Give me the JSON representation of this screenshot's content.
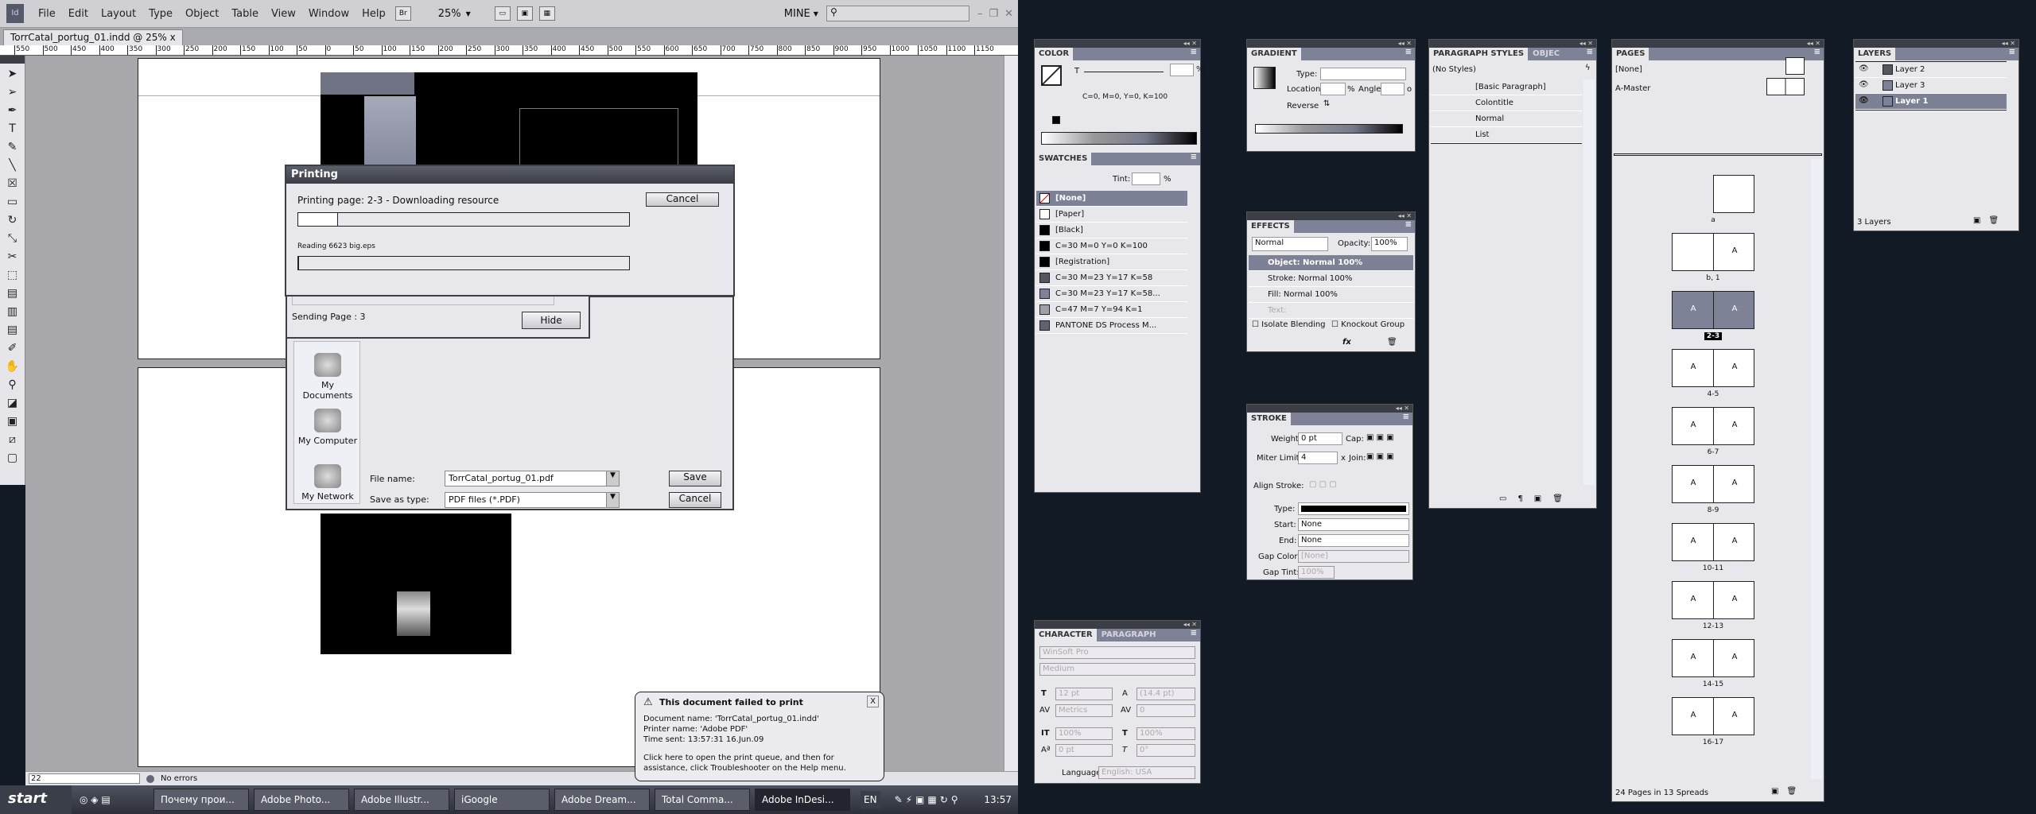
{
  "app": {
    "menu": [
      "File",
      "Edit",
      "Layout",
      "Type",
      "Object",
      "Table",
      "View",
      "Window",
      "Help"
    ],
    "bridge_label": "Br",
    "zoom": "25%",
    "workspace": "MINE",
    "search_placeholder": "",
    "window_controls": [
      "–",
      "❐",
      "✕"
    ],
    "doc_tab": "TorrCatal_portug_01.indd @ 25%",
    "doc_tab_close": "x"
  },
  "ruler_labels": [
    "550",
    "500",
    "450",
    "400",
    "350",
    "300",
    "250",
    "200",
    "150",
    "100",
    "50",
    "0",
    "50",
    "100",
    "150",
    "200",
    "250",
    "300",
    "350",
    "400",
    "450",
    "500",
    "550",
    "600",
    "650",
    "700",
    "750",
    "800",
    "850",
    "900",
    "950",
    "1000",
    "1050",
    "1100",
    "1150"
  ],
  "tools": [
    "selection-tool",
    "direct-selection-tool",
    "pen-tool",
    "type-tool",
    "pencil-tool",
    "line-tool",
    "rectangle-frame-tool",
    "rectangle-tool",
    "rotate-tool",
    "scale-tool",
    "scissors-tool",
    "free-transform-tool",
    "gradient-tool",
    "gradient-feather-tool",
    "note-tool",
    "eyedropper-tool",
    "hand-tool",
    "zoom-tool",
    "fill-stroke-tool",
    "formatting-tool",
    "apply-none-tool",
    "screen-mode-tool"
  ],
  "status": {
    "page": "22",
    "errors": "No errors"
  },
  "printing": {
    "title": "Printing",
    "status": "Printing page: 2-3 - Downloading resource",
    "progress": 0.12,
    "reading": "Reading 6623 big.eps",
    "progress2": 0.0,
    "cancel": "Cancel"
  },
  "sending": {
    "text": "Sending Page : 3",
    "hide": "Hide"
  },
  "save_dialog": {
    "places": [
      "My Documents",
      "My Computer",
      "My Network"
    ],
    "file_name_label": "File name:",
    "file_name": "TorrCatal_portug_01.pdf",
    "type_label": "Save as type:",
    "type": "PDF files (*.PDF)",
    "save": "Save",
    "cancel": "Cancel"
  },
  "balloon": {
    "title": "This document failed to print",
    "lines": [
      "Document name: 'TorrCatal_portug_01.indd'",
      "Printer name: 'Adobe PDF'",
      "Time sent: 13:57:31  16.Jun.09"
    ],
    "help": "Click here to open the print queue, and then for assistance, click Troubleshooter on the Help menu.",
    "close": "X"
  },
  "taskbar": {
    "start": "start",
    "items": [
      "Почему прои...",
      "Adobe Photo...",
      "Adobe Illustr...",
      "iGoogle",
      "Adobe Dream...",
      "Total Comma...",
      "Adobe InDesi..."
    ],
    "active": 6,
    "lang": "EN",
    "time": "13:57"
  },
  "color_panel": {
    "title": "COLOR",
    "t_label": "T",
    "pct": "%",
    "value": "C=0, M=0, Y=0, K=100"
  },
  "swatches": {
    "title": "SWATCHES",
    "tint_label": "Tint:",
    "pct": "%",
    "items": [
      {
        "name": "[None]",
        "color": "none"
      },
      {
        "name": "[Paper]",
        "color": "#ffffff"
      },
      {
        "name": "[Black]",
        "color": "#000000"
      },
      {
        "name": "C=30 M=0 Y=0 K=100",
        "color": "#000000"
      },
      {
        "name": "[Registration]",
        "color": "#000000"
      },
      {
        "name": "C=30 M=23 Y=17 K=58",
        "color": "#55575f"
      },
      {
        "name": "C=30 M=23 Y=17 K=58...",
        "color": "#7d8296"
      },
      {
        "name": "C=47 M=7 Y=94 K=1",
        "color": "#a0a0a8"
      },
      {
        "name": "PANTONE DS Process M...",
        "color": "#606270"
      }
    ]
  },
  "gradient": {
    "title": "GRADIENT",
    "type_label": "Type:",
    "location_label": "Location:",
    "pct": "%",
    "angle_label": "Angle:",
    "deg": "o",
    "reverse_label": "Reverse"
  },
  "effects": {
    "title": "EFFECTS",
    "mode": "Normal",
    "opacity_label": "Opacity:",
    "opacity": "100%",
    "rows": [
      "Object: Normal 100%",
      "Stroke:  Normal 100%",
      "Fill:      Normal 100%",
      "Text:"
    ],
    "isolate": "Isolate Blending",
    "knockout": "Knockout Group"
  },
  "stroke": {
    "title": "STROKE",
    "weight_label": "Weight:",
    "weight": "0 pt",
    "cap_label": "Cap:",
    "miter_label": "Miter Limit:",
    "miter": "4",
    "x": "x",
    "join_label": "Join:",
    "align_label": "Align Stroke:",
    "type_label": "Type:",
    "start_label": "Start:",
    "start": "None",
    "end_label": "End:",
    "end": "None",
    "gap_color_label": "Gap Color:",
    "gap_color": "[None]",
    "gap_tint_label": "Gap Tint:",
    "gap_tint": "100%"
  },
  "character": {
    "title": "CHARACTER",
    "tab2": "PARAGRAPH",
    "font": "WinSoft Pro",
    "style": "Medium",
    "size": "12 pt",
    "leading": "(14.4 pt)",
    "kerning": "Metrics",
    "tracking": "0",
    "vscale": "100%",
    "hscale": "100%",
    "baseline": "0 pt",
    "skew": "0°",
    "language_label": "Language:",
    "language": "English: USA"
  },
  "paragraph_styles": {
    "title": "PARAGRAPH STYLES",
    "tab2": "OBJEC",
    "current": "(No Styles)",
    "items": [
      "[Basic Paragraph]",
      "Colontitle",
      "Normal",
      "List"
    ]
  },
  "pages": {
    "title": "PAGES",
    "masters": [
      "[None]",
      "A-Master"
    ],
    "spreads": [
      {
        "label": "a",
        "left": null,
        "right": ""
      },
      {
        "label": "b, 1",
        "left": "",
        "right": "A"
      },
      {
        "label": "2-3",
        "left": "A",
        "right": "A",
        "selected": true
      },
      {
        "label": "4-5",
        "left": "A",
        "right": "A"
      },
      {
        "label": "6-7",
        "left": "A",
        "right": "A"
      },
      {
        "label": "8-9",
        "left": "A",
        "right": "A"
      },
      {
        "label": "10-11",
        "left": "A",
        "right": "A"
      },
      {
        "label": "12-13",
        "left": "A",
        "right": "A"
      },
      {
        "label": "14-15",
        "left": "A",
        "right": "A"
      },
      {
        "label": "16-17",
        "left": "A",
        "right": "A"
      }
    ],
    "footer": "24 Pages in 13 Spreads"
  },
  "layers": {
    "title": "LAYERS",
    "items": [
      {
        "name": "Layer 2",
        "color": "#55575f"
      },
      {
        "name": "Layer 3",
        "color": "#7d8296"
      },
      {
        "name": "Layer 1",
        "color": "#7d8296",
        "selected": true
      }
    ],
    "footer": "3 Layers"
  },
  "colors": {
    "panel_bg": "#e8e7ec",
    "accent": "#7d8296",
    "desktop": "#121a26"
  }
}
